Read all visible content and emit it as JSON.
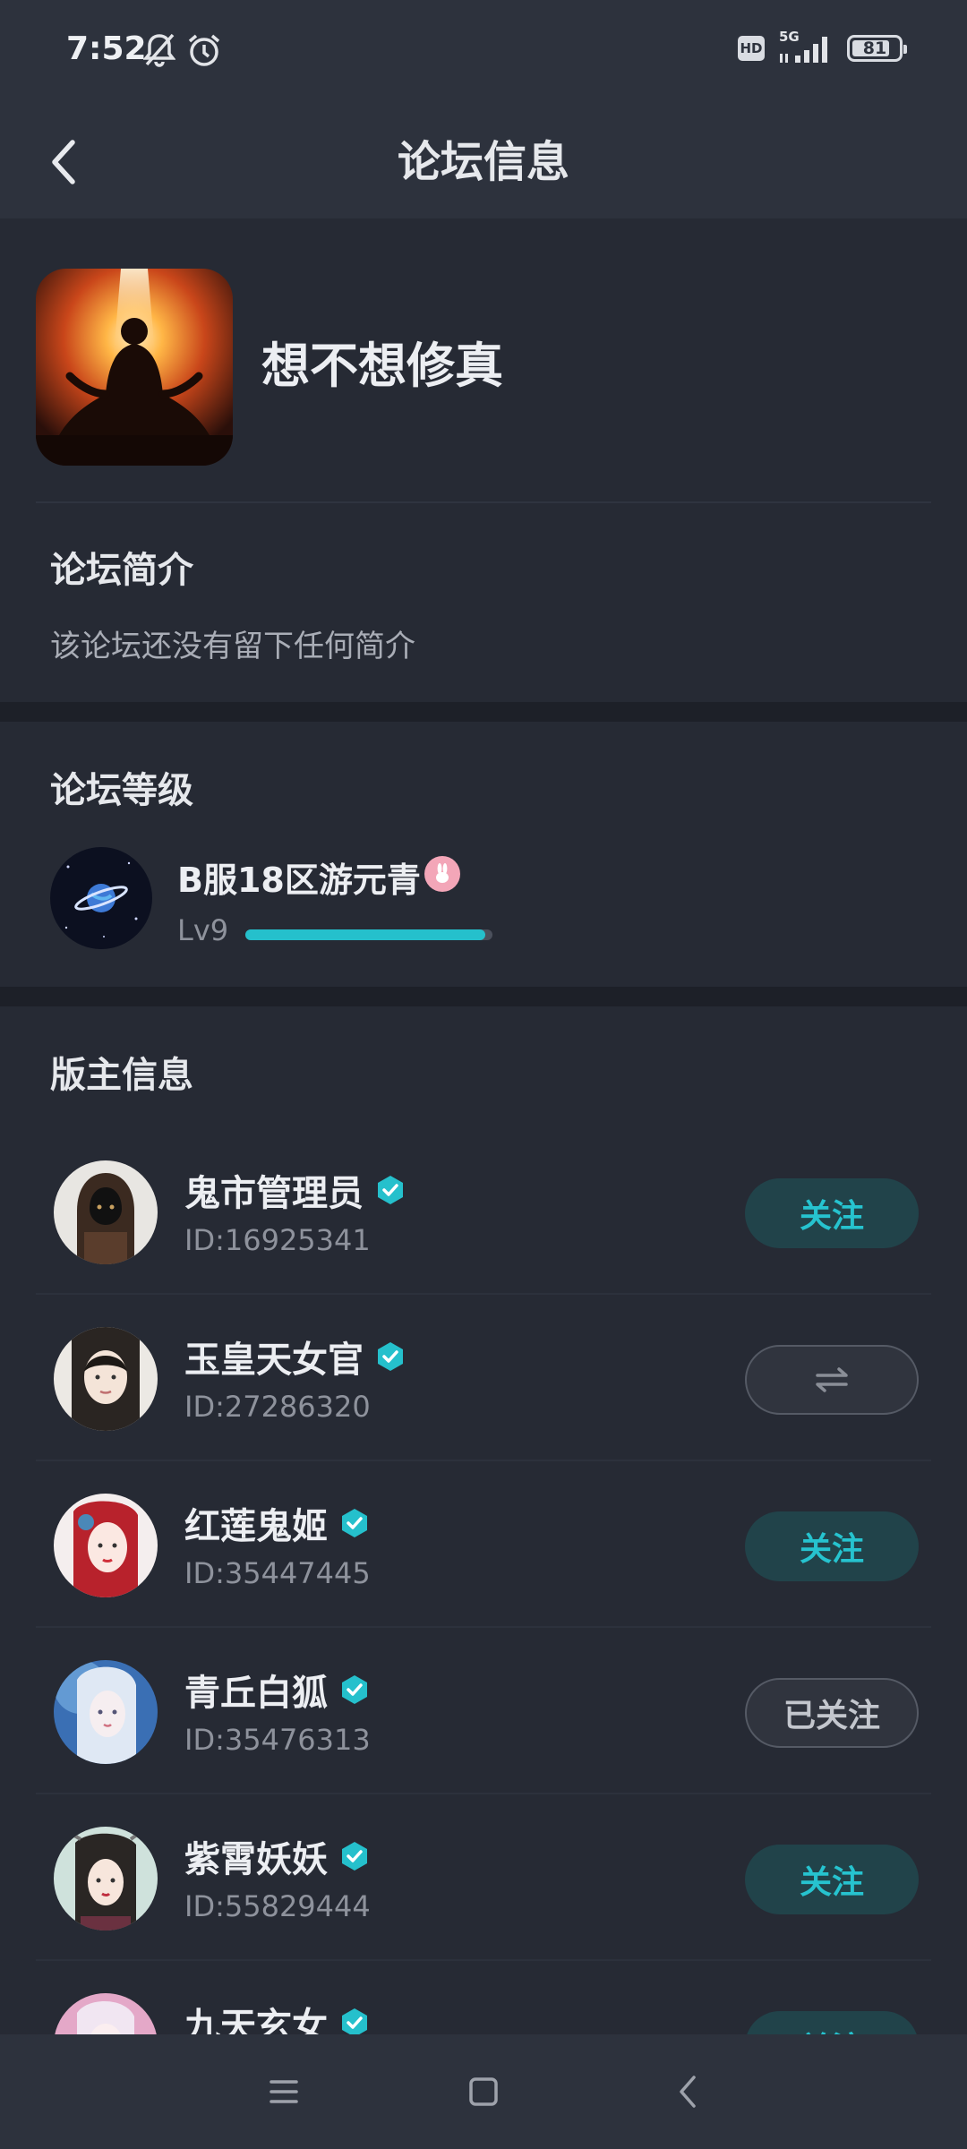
{
  "status_bar": {
    "time": "7:52",
    "hd": "HD",
    "network": "5G",
    "battery": "81",
    "battery_level": 0.81,
    "icons": [
      "bell-off-icon",
      "alarm-icon",
      "signal-icon",
      "battery-icon"
    ]
  },
  "header": {
    "title": "论坛信息",
    "back_icon": "chevron-left-icon"
  },
  "forum": {
    "name": "想不想修真",
    "intro_title": "论坛简介",
    "intro_text": "该论坛还没有留下任何简介"
  },
  "level": {
    "title": "论坛等级",
    "user_name": "B服18区游元青",
    "level_label": "Lv9",
    "progress": 0.97
  },
  "moderators": {
    "title": "版主信息",
    "items": [
      {
        "name": "鬼市管理员",
        "id": "ID:16925341",
        "button": "关注",
        "state": "follow"
      },
      {
        "name": "玉皇天女官",
        "id": "ID:27286320",
        "button": "",
        "state": "mutual"
      },
      {
        "name": "红莲鬼姬",
        "id": "ID:35447445",
        "button": "关注",
        "state": "follow"
      },
      {
        "name": "青丘白狐",
        "id": "ID:35476313",
        "button": "已关注",
        "state": "followed"
      },
      {
        "name": "紫霄妖妖",
        "id": "ID:55829444",
        "button": "关注",
        "state": "follow"
      },
      {
        "name": "九天玄女",
        "id": "",
        "button": "关注",
        "state": "follow"
      }
    ]
  },
  "colors": {
    "accent": "#26c3cf",
    "background": "#262a34",
    "header": "#2d323d"
  },
  "nav": {
    "icons": [
      "menu-icon",
      "home-square-icon",
      "back-triangle-icon"
    ]
  }
}
